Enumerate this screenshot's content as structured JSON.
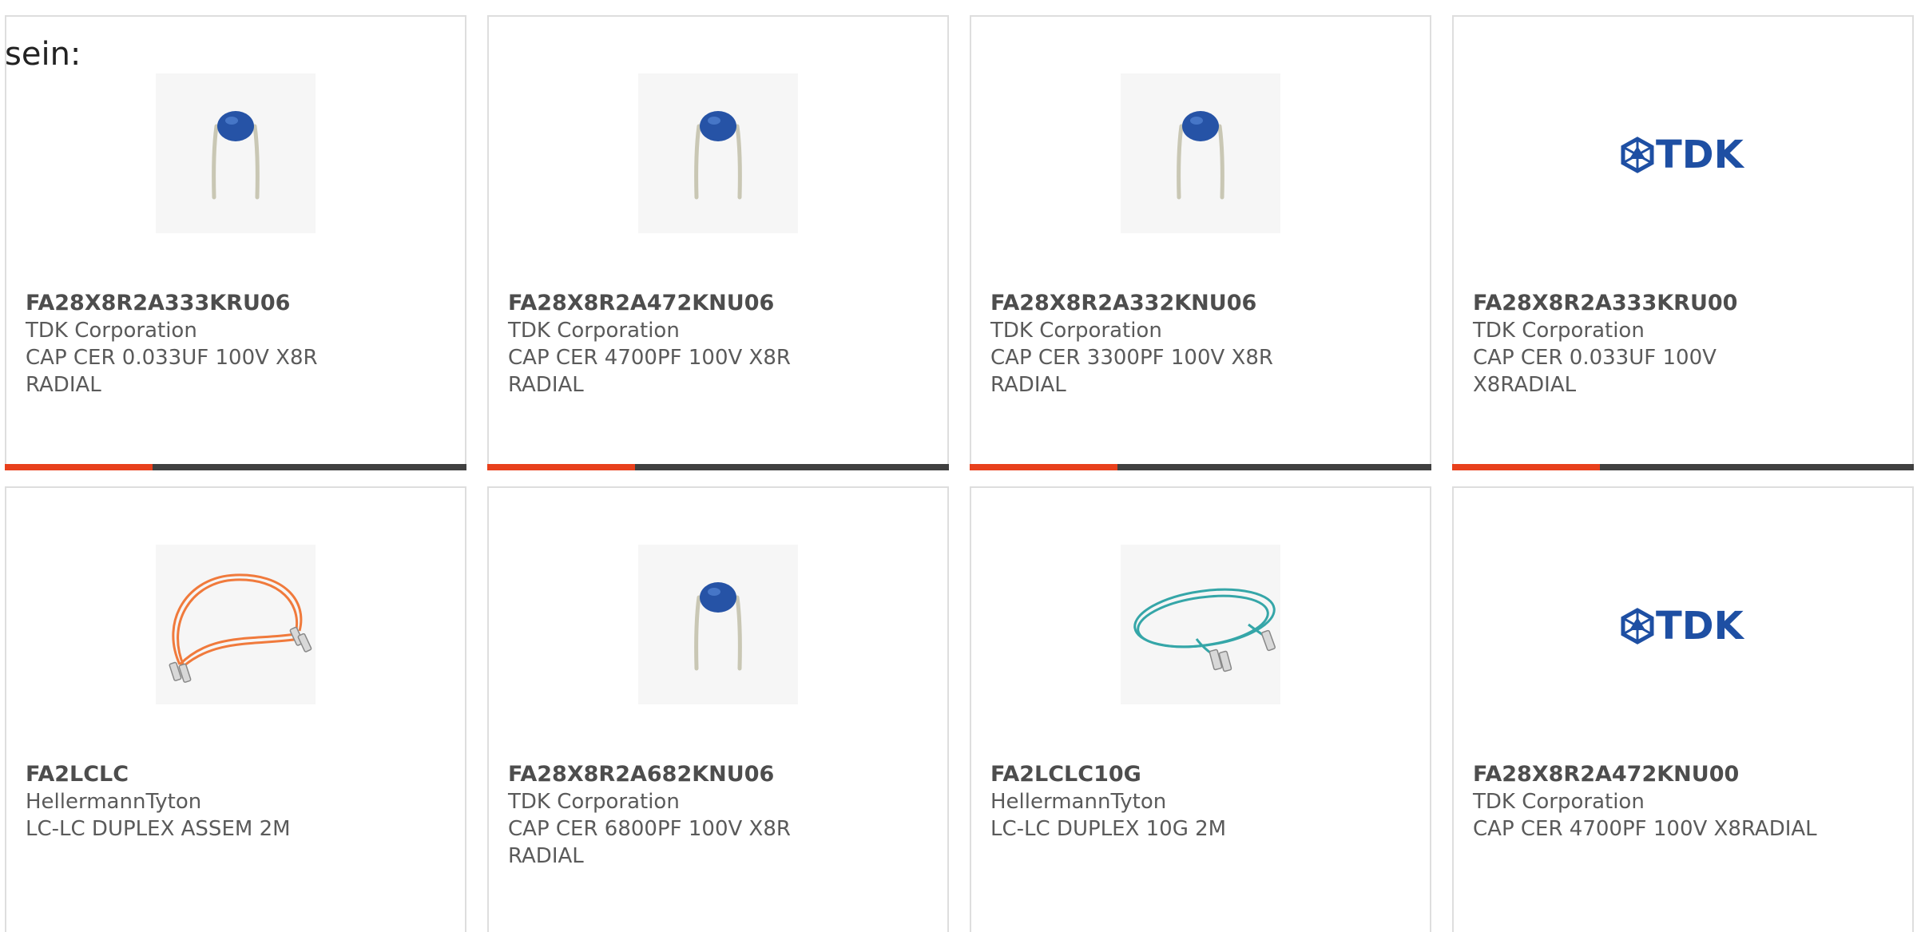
{
  "intro_text": "sein:",
  "colors": {
    "accent": "#e8401c",
    "bar_track": "#404040",
    "card_border": "#dedede",
    "capacitor_blue": "#2653a6",
    "tdk_blue": "#1e4fa3",
    "fiber_orange": "#f07a3c",
    "fiber_aqua": "#35a6a8"
  },
  "products": [
    {
      "part_number": "FA28X8R2A333KRU06",
      "manufacturer": "TDK Corporation",
      "description_lines": [
        "CAP CER 0.033UF 100V X8R",
        "RADIAL"
      ],
      "image": "capacitor-image",
      "progress": 0.32
    },
    {
      "part_number": "FA28X8R2A472KNU06",
      "manufacturer": "TDK Corporation",
      "description_lines": [
        "CAP CER 4700PF 100V X8R",
        "RADIAL"
      ],
      "image": "capacitor-image",
      "progress": 0.32
    },
    {
      "part_number": "FA28X8R2A332KNU06",
      "manufacturer": "TDK Corporation",
      "description_lines": [
        "CAP CER 3300PF 100V X8R",
        "RADIAL"
      ],
      "image": "capacitor-image",
      "progress": 0.32
    },
    {
      "part_number": "FA28X8R2A333KRU00",
      "manufacturer": "TDK Corporation",
      "description_lines": [
        "CAP CER 0.033UF 100V",
        "X8RADIAL"
      ],
      "image": "tdk-logo",
      "logo_text": "TDK",
      "progress": 0.32
    },
    {
      "part_number": "FA2LCLC",
      "manufacturer": "HellermannTyton",
      "description_lines": [
        "LC-LC DUPLEX ASSEM 2M"
      ],
      "image": "orange-fiber-cable-image"
    },
    {
      "part_number": "FA28X8R2A682KNU06",
      "manufacturer": "TDK Corporation",
      "description_lines": [
        "CAP CER 6800PF 100V X8R",
        "RADIAL"
      ],
      "image": "capacitor-image"
    },
    {
      "part_number": "FA2LCLC10G",
      "manufacturer": "HellermannTyton",
      "description_lines": [
        "LC-LC DUPLEX 10G 2M"
      ],
      "image": "aqua-fiber-cable-image"
    },
    {
      "part_number": "FA28X8R2A472KNU00",
      "manufacturer": "TDK Corporation",
      "description_lines": [
        "CAP CER 4700PF 100V X8RADIAL"
      ],
      "image": "tdk-logo",
      "logo_text": "TDK"
    }
  ]
}
